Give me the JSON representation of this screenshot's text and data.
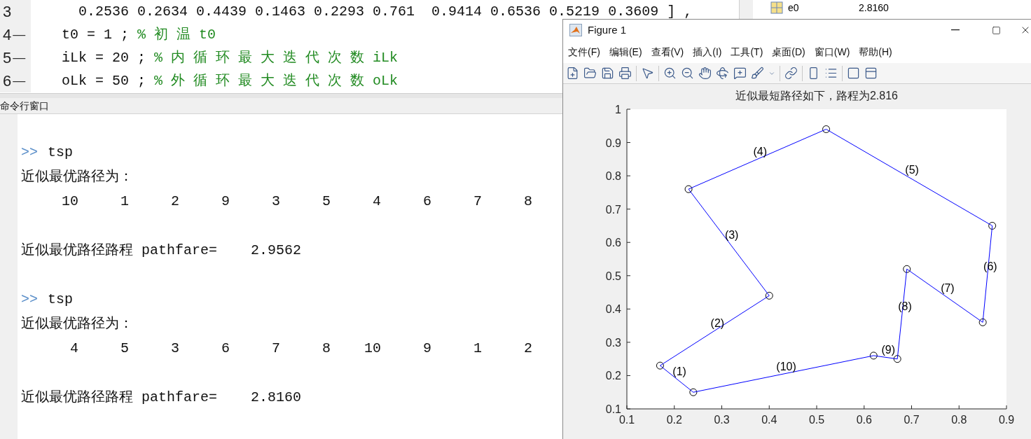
{
  "editor": {
    "lines": [
      {
        "number": "3",
        "code": "  0.2536 0.2634 0.4439 0.1463 0.2293 0.761  0.9414 0.6536 0.5219 0.3609 ] ,"
      },
      {
        "number": "4",
        "marker": "—",
        "code": "t0 = 1 ; ",
        "comment": "% 初 温 t0"
      },
      {
        "number": "5",
        "marker": "—",
        "code": "iLk = 20 ; ",
        "comment": "% 内 循 环 最 大 迭 代 次 数 iLk"
      },
      {
        "number": "6",
        "marker": "—",
        "code": "oLk = 50 ; ",
        "comment": "% 外 循 环 最 大 迭 代 次 数 oLk"
      }
    ]
  },
  "command_window": {
    "title": "命令行窗口",
    "entries": [
      {
        "kind": "prompt",
        "prompt": ">>",
        "text": "tsp"
      },
      {
        "kind": "text",
        "text": "近似最优路径为："
      },
      {
        "kind": "numbers",
        "values": [
          "10",
          "1",
          "2",
          "9",
          "3",
          "5",
          "4",
          "6",
          "7",
          "8"
        ]
      },
      {
        "kind": "result",
        "text": "近似最优路径路程 pathfare=",
        "value": "2.9562"
      },
      {
        "kind": "prompt",
        "prompt": ">>",
        "text": "tsp"
      },
      {
        "kind": "text",
        "text": "近似最优路径为："
      },
      {
        "kind": "numbers",
        "values": [
          "4",
          "5",
          "3",
          "6",
          "7",
          "8",
          "10",
          "9",
          "1",
          "2"
        ]
      },
      {
        "kind": "result",
        "text": "近似最优路径路程 pathfare=",
        "value": "2.8160"
      }
    ]
  },
  "workspace": {
    "rows": [
      {
        "name": "e0",
        "value": "2.8160"
      }
    ]
  },
  "figure": {
    "title": "Figure 1",
    "menu": [
      "文件(F)",
      "编辑(E)",
      "查看(V)",
      "插入(I)",
      "工具(T)",
      "桌面(D)",
      "窗口(W)",
      "帮助(H)"
    ],
    "chart_data": {
      "type": "line",
      "title": "近似最短路径如下，路程为2.816",
      "series": [
        {
          "type": "scatter",
          "color": "#000000",
          "x": [
            0.24,
            0.17,
            0.4,
            0.23,
            0.52,
            0.87,
            0.85,
            0.69,
            0.67,
            0.62
          ],
          "values": [
            0.15,
            0.23,
            0.44,
            0.76,
            0.94,
            0.65,
            0.36,
            0.52,
            0.25,
            0.26
          ]
        },
        {
          "color": "#0000ff",
          "x": [
            0.17,
            0.24
          ],
          "values": [
            0.23,
            0.15
          ]
        },
        {
          "color": "#0000ff",
          "x": [
            0.17,
            0.4
          ],
          "values": [
            0.23,
            0.44
          ]
        },
        {
          "color": "#0000ff",
          "x": [
            0.23,
            0.4
          ],
          "values": [
            0.76,
            0.44
          ]
        },
        {
          "color": "#0000ff",
          "x": [
            0.23,
            0.52
          ],
          "values": [
            0.76,
            0.94
          ]
        },
        {
          "color": "#0000ff",
          "x": [
            0.52,
            0.87
          ],
          "values": [
            0.94,
            0.65
          ]
        },
        {
          "color": "#0000ff",
          "x": [
            0.85,
            0.87
          ],
          "values": [
            0.36,
            0.65
          ]
        },
        {
          "color": "#0000ff",
          "x": [
            0.69,
            0.85
          ],
          "values": [
            0.52,
            0.36
          ]
        },
        {
          "color": "#0000ff",
          "x": [
            0.67,
            0.69
          ],
          "values": [
            0.25,
            0.52
          ]
        },
        {
          "color": "#0000ff",
          "x": [
            0.62,
            0.67
          ],
          "values": [
            0.26,
            0.25
          ]
        },
        {
          "color": "#0000ff",
          "x": [
            0.24,
            0.62
          ],
          "values": [
            0.15,
            0.26
          ]
        }
      ],
      "xlim": [
        0.1,
        0.9
      ],
      "ylim": [
        0.1,
        1
      ],
      "xticks": [
        0.1,
        0.2,
        0.3,
        0.4,
        0.5,
        0.6,
        0.7,
        0.8,
        0.9
      ],
      "yticks": [
        0.1,
        0.2,
        0.3,
        0.4,
        0.5,
        0.6,
        0.7,
        0.8,
        0.9,
        1
      ],
      "annotations": [
        "(1)",
        "(2)",
        "(3)",
        "(4)",
        "(5)",
        "(6)",
        "(7)",
        "(8)",
        "(9)",
        "(10)"
      ]
    }
  }
}
